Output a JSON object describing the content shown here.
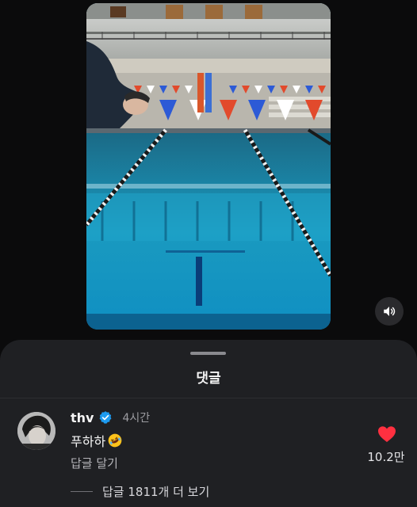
{
  "comments_sheet": {
    "title": "댓글",
    "comment": {
      "username": "thv",
      "verified": true,
      "timestamp": "4시간",
      "text": "푸하하",
      "emoji": "rolling-on-floor-laughing-emoji",
      "reply_label": "답글 달기",
      "likes": "10.2만",
      "liked": true
    },
    "more_replies_label": "답글 1811개 더 보기"
  },
  "colors": {
    "sheet_background": "#1f2023",
    "page_background": "#0b0b0c",
    "like_heart": "#ff3040",
    "verified_badge": "#1d9bf0"
  },
  "icons": {
    "volume": "speaker-volume-icon",
    "like": "heart-icon",
    "verified": "verified-badge-icon"
  }
}
